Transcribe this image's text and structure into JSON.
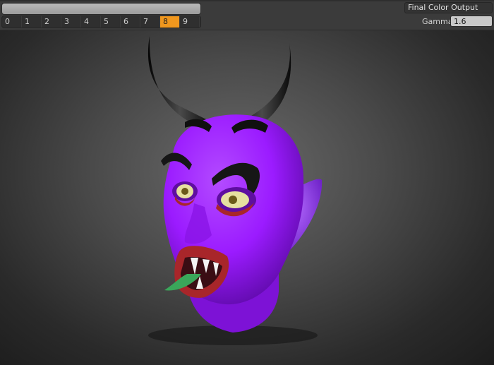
{
  "toolbar": {
    "name_field": "",
    "slots": [
      "0",
      "1",
      "2",
      "3",
      "4",
      "5",
      "6",
      "7",
      "8",
      "9"
    ],
    "active_slot": "8",
    "output_select": "Final Color Output",
    "gamma_label": "Gamma",
    "gamma_value": "1.6"
  },
  "viewport": {
    "subject": "devil-head",
    "colors": {
      "skin": "#9b1bff",
      "horn": "#1a1a1a",
      "lips": "#a8262a",
      "tongue": "#3aa65a",
      "eye": "#e6e0a0"
    }
  }
}
